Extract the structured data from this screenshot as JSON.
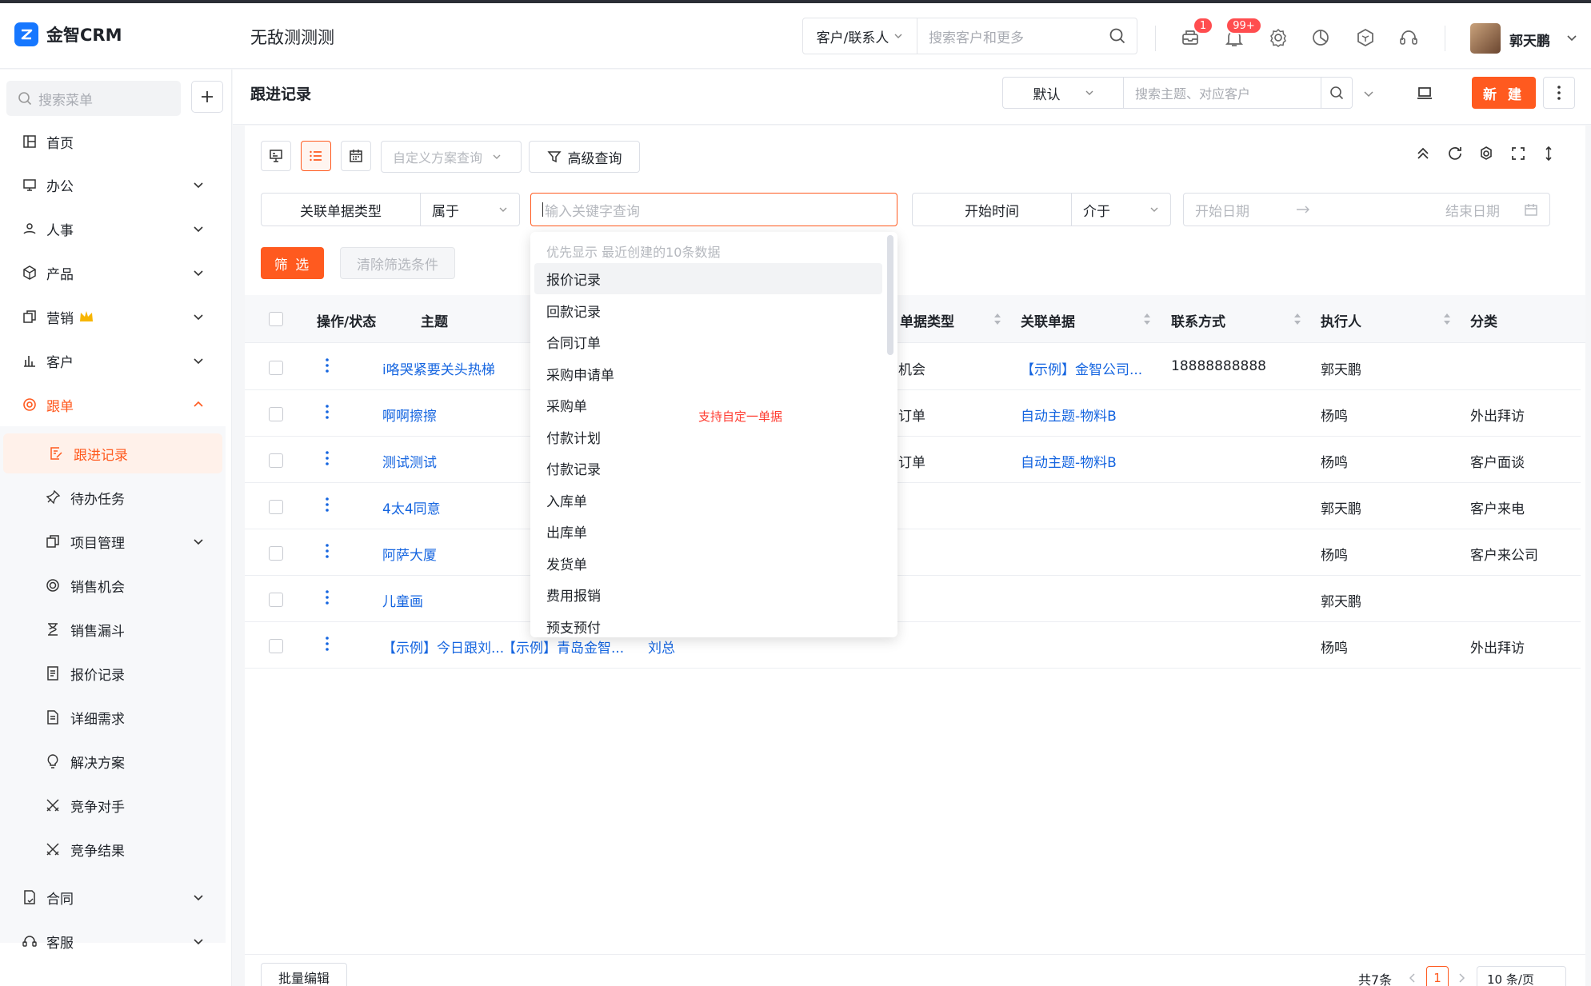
{
  "app": {
    "name": "金智CRM",
    "tenant": "无敌测测测"
  },
  "header": {
    "search_type": "客户/联系人",
    "search_placeholder": "搜索客户和更多",
    "message_badge": "1",
    "notice_badge": "99+",
    "user_name": "郭天鹏"
  },
  "sidebar": {
    "search_placeholder": "搜索菜单",
    "items": [
      {
        "label": "首页",
        "icon": "home-icon"
      },
      {
        "label": "办公",
        "icon": "office-icon"
      },
      {
        "label": "人事",
        "icon": "hr-icon"
      },
      {
        "label": "产品",
        "icon": "box-icon"
      },
      {
        "label": "营销",
        "icon": "copy-icon"
      },
      {
        "label": "客户",
        "icon": "chart-icon"
      },
      {
        "label": "跟单",
        "icon": "target-icon"
      }
    ],
    "sub_items": [
      "跟进记录",
      "待办任务",
      "项目管理",
      "销售机会",
      "销售漏斗",
      "报价记录",
      "详细需求",
      "解决方案",
      "竞争对手",
      "竞争结果"
    ],
    "bottom_items": [
      "合同",
      "客服"
    ]
  },
  "page": {
    "title": "跟进记录",
    "view_select": "默认",
    "topic_search_placeholder": "搜索主题、对应客户",
    "new_button": "新 建"
  },
  "toolbar": {
    "custom_query_placeholder": "自定义方案查询",
    "advanced_query": "高级查询"
  },
  "filters": {
    "doc_type_label": "关联单据类型",
    "doc_type_op": "属于",
    "keyword_placeholder": "输入关键字查询",
    "time_label": "开始时间",
    "time_op": "介于",
    "start_placeholder": "开始日期",
    "end_placeholder": "结束日期",
    "screen_button": "筛 选",
    "clear_button": "清除筛选条件"
  },
  "table": {
    "headers": [
      "操作/状态",
      "主题",
      "单据类型",
      "关联单据",
      "联系方式",
      "执行人",
      "分类"
    ],
    "rows": [
      {
        "subject": "i咯哭紧要关头热梯",
        "extra1": "",
        "extra2": "",
        "doc_type": "机会",
        "doc": "【示例】金智公司...",
        "contact": "18888888888",
        "owner": "郭天鹏",
        "category": ""
      },
      {
        "subject": "啊啊擦擦",
        "extra1": "",
        "extra2": "",
        "doc_type": "订单",
        "doc": "自动主题-物料B",
        "contact": "",
        "owner": "杨鸣",
        "category": "外出拜访"
      },
      {
        "subject": "测试测试",
        "extra1": "",
        "extra2": "",
        "doc_type": "订单",
        "doc": "自动主题-物料B",
        "contact": "",
        "owner": "杨鸣",
        "category": "客户面谈"
      },
      {
        "subject": "4太4同意",
        "extra1": "",
        "extra2": "",
        "doc_type": "",
        "doc": "",
        "contact": "",
        "owner": "郭天鹏",
        "category": "客户来电"
      },
      {
        "subject": "阿萨大厦",
        "extra1": "",
        "extra2": "",
        "doc_type": "",
        "doc": "",
        "contact": "",
        "owner": "杨鸣",
        "category": "客户来公司"
      },
      {
        "subject": "儿童画",
        "extra1": "",
        "extra2": "",
        "doc_type": "",
        "doc": "",
        "contact": "",
        "owner": "郭天鹏",
        "category": ""
      },
      {
        "subject": "【示例】今日跟刘...",
        "extra1": "【示例】青岛金智...",
        "extra2": "刘总",
        "doc_type": "",
        "doc": "",
        "contact": "",
        "owner": "杨鸣",
        "category": "外出拜访"
      }
    ]
  },
  "dropdown": {
    "hint": "优先显示 最近创建的10条数据",
    "items": [
      "报价记录",
      "回款记录",
      "合同订单",
      "采购申请单",
      "采购单",
      "付款计划",
      "付款记录",
      "入库单",
      "出库单",
      "发货单",
      "费用报销",
      "预支预付"
    ],
    "note": "支持自定一单据"
  },
  "footer": {
    "batch_edit": "批量编辑",
    "total": "共7条",
    "page": "1",
    "page_size": "10 条/页"
  },
  "colors": {
    "accent": "#ff5a1f",
    "link": "#1565e0",
    "brand": "#1677ff"
  }
}
